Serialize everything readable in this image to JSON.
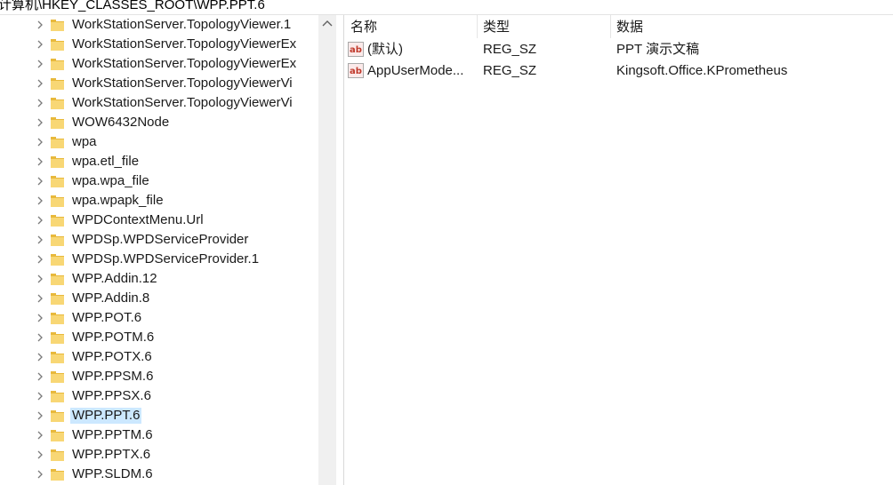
{
  "address_bar": {
    "path": "计算机\\HKEY_CLASSES_ROOT\\WPP.PPT.6"
  },
  "tree": {
    "items": [
      {
        "label": "WorkStationServer.TopologyViewer.1"
      },
      {
        "label": "WorkStationServer.TopologyViewerEx"
      },
      {
        "label": "WorkStationServer.TopologyViewerEx"
      },
      {
        "label": "WorkStationServer.TopologyViewerVi"
      },
      {
        "label": "WorkStationServer.TopologyViewerVi"
      },
      {
        "label": "WOW6432Node"
      },
      {
        "label": "wpa"
      },
      {
        "label": "wpa.etl_file"
      },
      {
        "label": "wpa.wpa_file"
      },
      {
        "label": "wpa.wpapk_file"
      },
      {
        "label": "WPDContextMenu.Url"
      },
      {
        "label": "WPDSp.WPDServiceProvider"
      },
      {
        "label": "WPDSp.WPDServiceProvider.1"
      },
      {
        "label": "WPP.Addin.12"
      },
      {
        "label": "WPP.Addin.8"
      },
      {
        "label": "WPP.POT.6"
      },
      {
        "label": "WPP.POTM.6"
      },
      {
        "label": "WPP.POTX.6"
      },
      {
        "label": "WPP.PPSM.6"
      },
      {
        "label": "WPP.PPSX.6"
      },
      {
        "label": "WPP.PPT.6",
        "selected": true
      },
      {
        "label": "WPP.PPTM.6"
      },
      {
        "label": "WPP.PPTX.6"
      },
      {
        "label": "WPP.SLDM.6"
      }
    ]
  },
  "list": {
    "columns": {
      "name": "名称",
      "type": "类型",
      "data": "数据"
    },
    "rows": [
      {
        "icon": "string-value-icon",
        "name": "(默认)",
        "type": "REG_SZ",
        "data": "PPT 演示文稿"
      },
      {
        "icon": "string-value-icon",
        "name": "AppUserMode...",
        "type": "REG_SZ",
        "data": "Kingsoft.Office.KPrometheus"
      }
    ]
  },
  "colors": {
    "selection": "#cce8ff",
    "folder": "#f8d775",
    "folder_dark": "#e8b93c",
    "scrollbar": "#f0f0f0",
    "icon_red": "#c0392b"
  }
}
